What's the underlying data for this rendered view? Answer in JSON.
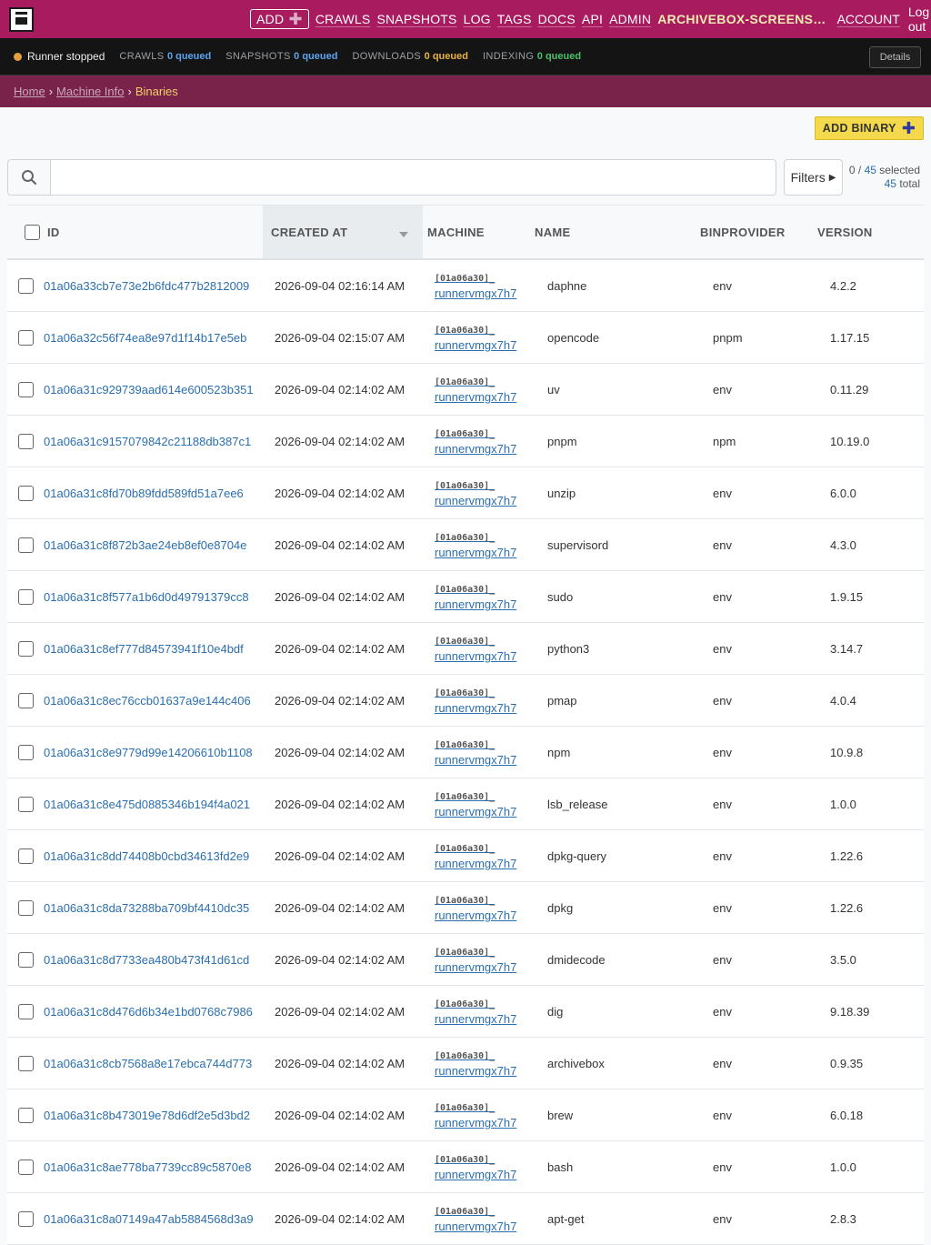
{
  "nav": {
    "add_label": "ADD",
    "links": [
      "CRAWLS",
      "SNAPSHOTS",
      "LOG",
      "TAGS",
      "DOCS",
      "API",
      "ADMIN"
    ],
    "site_name": "ARCHIVEBOX-SCREENS…",
    "account": "ACCOUNT",
    "logout": "Log out"
  },
  "status": {
    "runner": "Runner stopped",
    "crawls_label": "CRAWLS",
    "crawls_value": "0 queued",
    "snapshots_label": "SNAPSHOTS",
    "snapshots_value": "0 queued",
    "downloads_label": "DOWNLOADS",
    "downloads_value": "0 queued",
    "indexing_label": "INDEXING",
    "indexing_value": "0 queued",
    "details": "Details"
  },
  "breadcrumbs": {
    "home": "Home",
    "machine": "Machine Info",
    "current": "Binaries"
  },
  "toolbar": {
    "add_binary": "ADD BINARY",
    "filters": "Filters",
    "selected_prefix": "0 / ",
    "selected_count": "45",
    "selected_suffix": " selected",
    "total_count": "45",
    "total_suffix": " total"
  },
  "table": {
    "headers": {
      "id": "ID",
      "created": "CREATED AT",
      "machine": "MACHINE",
      "name": "NAME",
      "provider": "BINPROVIDER",
      "version": "VERSION"
    },
    "machine_id": "[01a06a30]_",
    "machine_name": "runnervmgx7h7",
    "rows": [
      {
        "id": "01a06a33cb7e73e2b6fdc477b2812009",
        "created": "2026-09-04 02:16:14 AM",
        "name": "daphne",
        "provider": "env",
        "version": "4.2.2"
      },
      {
        "id": "01a06a32c56f74ea8e97d1f14b17e5eb",
        "created": "2026-09-04 02:15:07 AM",
        "name": "opencode",
        "provider": "pnpm",
        "version": "1.17.15"
      },
      {
        "id": "01a06a31c929739aad614e600523b351",
        "created": "2026-09-04 02:14:02 AM",
        "name": "uv",
        "provider": "env",
        "version": "0.11.29"
      },
      {
        "id": "01a06a31c9157079842c21188db387c1",
        "created": "2026-09-04 02:14:02 AM",
        "name": "pnpm",
        "provider": "npm",
        "version": "10.19.0"
      },
      {
        "id": "01a06a31c8fd70b89fdd589fd51a7ee6",
        "created": "2026-09-04 02:14:02 AM",
        "name": "unzip",
        "provider": "env",
        "version": "6.0.0"
      },
      {
        "id": "01a06a31c8f872b3ae24eb8ef0e8704e",
        "created": "2026-09-04 02:14:02 AM",
        "name": "supervisord",
        "provider": "env",
        "version": "4.3.0"
      },
      {
        "id": "01a06a31c8f577a1b6d0d49791379cc8",
        "created": "2026-09-04 02:14:02 AM",
        "name": "sudo",
        "provider": "env",
        "version": "1.9.15"
      },
      {
        "id": "01a06a31c8ef777d84573941f10e4bdf",
        "created": "2026-09-04 02:14:02 AM",
        "name": "python3",
        "provider": "env",
        "version": "3.14.7"
      },
      {
        "id": "01a06a31c8ec76ccb01637a9e144c406",
        "created": "2026-09-04 02:14:02 AM",
        "name": "pmap",
        "provider": "env",
        "version": "4.0.4"
      },
      {
        "id": "01a06a31c8e9779d99e14206610b1108",
        "created": "2026-09-04 02:14:02 AM",
        "name": "npm",
        "provider": "env",
        "version": "10.9.8"
      },
      {
        "id": "01a06a31c8e475d0885346b194f4a021",
        "created": "2026-09-04 02:14:02 AM",
        "name": "lsb_release",
        "provider": "env",
        "version": "1.0.0"
      },
      {
        "id": "01a06a31c8dd74408b0cbd34613fd2e9",
        "created": "2026-09-04 02:14:02 AM",
        "name": "dpkg-query",
        "provider": "env",
        "version": "1.22.6"
      },
      {
        "id": "01a06a31c8da73288ba709bf4410dc35",
        "created": "2026-09-04 02:14:02 AM",
        "name": "dpkg",
        "provider": "env",
        "version": "1.22.6"
      },
      {
        "id": "01a06a31c8d7733ea480b473f41d61cd",
        "created": "2026-09-04 02:14:02 AM",
        "name": "dmidecode",
        "provider": "env",
        "version": "3.5.0"
      },
      {
        "id": "01a06a31c8d476d6b34e1bd0768c7986",
        "created": "2026-09-04 02:14:02 AM",
        "name": "dig",
        "provider": "env",
        "version": "9.18.39"
      },
      {
        "id": "01a06a31c8cb7568a8e17ebca744d773",
        "created": "2026-09-04 02:14:02 AM",
        "name": "archivebox",
        "provider": "env",
        "version": "0.9.35"
      },
      {
        "id": "01a06a31c8b473019e78d6df2e5d3bd2",
        "created": "2026-09-04 02:14:02 AM",
        "name": "brew",
        "provider": "env",
        "version": "6.0.18"
      },
      {
        "id": "01a06a31c8ae778ba7739cc89c5870e8",
        "created": "2026-09-04 02:14:02 AM",
        "name": "bash",
        "provider": "env",
        "version": "1.0.0"
      },
      {
        "id": "01a06a31c8a07149a47ab5884568d3a9",
        "created": "2026-09-04 02:14:02 AM",
        "name": "apt-get",
        "provider": "env",
        "version": "2.8.3"
      }
    ]
  },
  "colors": {
    "topbar": "#a91b5f",
    "statusbar": "#141414",
    "breadcrumbs": "#79224a",
    "accent_button": "#f3d94b",
    "link": "#2a6fb0"
  },
  "icons": [
    "archivebox-logo-icon",
    "plus-icon",
    "search-icon",
    "triangle-right-icon",
    "sort-desc-icon",
    "status-dot-icon"
  ]
}
